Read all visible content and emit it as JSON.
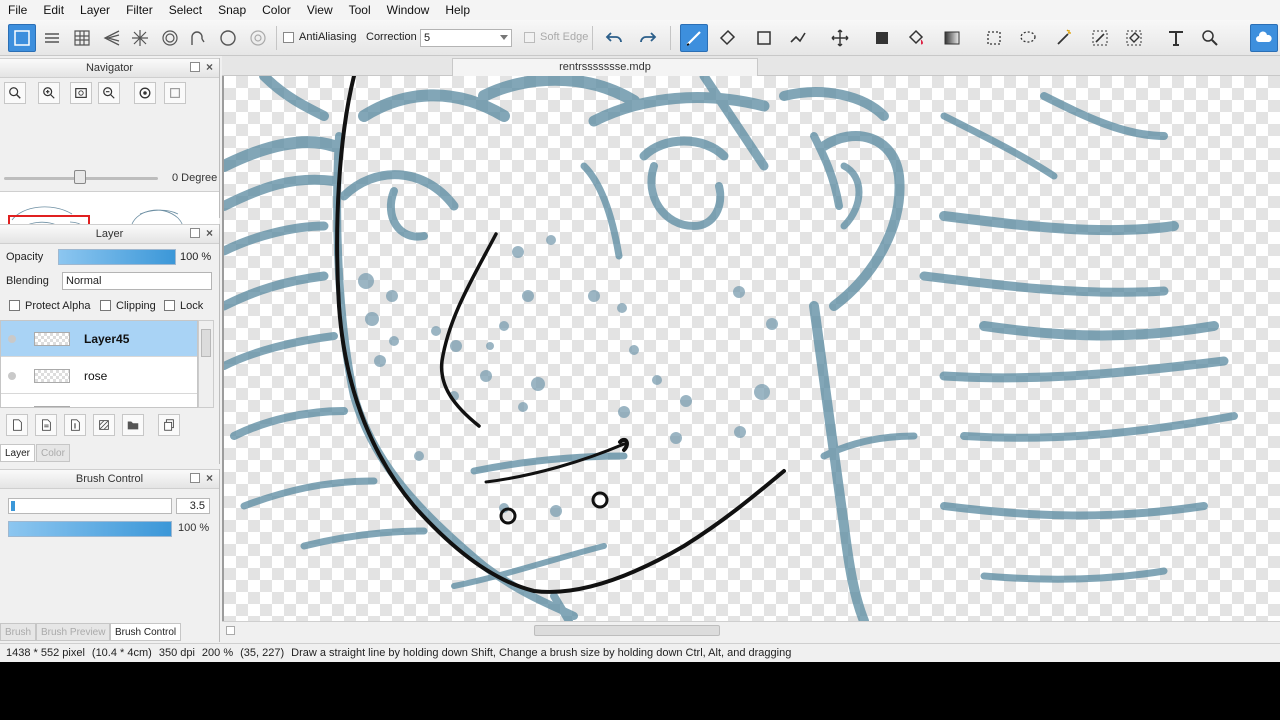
{
  "menu": [
    "File",
    "Edit",
    "Layer",
    "Filter",
    "Select",
    "Snap",
    "Color",
    "View",
    "Tool",
    "Window",
    "Help"
  ],
  "toolbar": {
    "antialiasing_label": "AntiAliasing",
    "correction_label": "Correction",
    "correction_value": "5",
    "soft_edge_label": "Soft Edge",
    "active_tool": "brush-icon"
  },
  "navigator": {
    "title": "Navigator",
    "rotation": "0 Degree"
  },
  "layer_panel": {
    "title": "Layer",
    "opacity_label": "Opacity",
    "opacity_value": "100 %",
    "opacity_fraction": 1.0,
    "blending_label": "Blending",
    "blending_value": "Normal",
    "protect_alpha_label": "Protect Alpha",
    "clipping_label": "Clipping",
    "lock_label": "Lock",
    "layers": [
      {
        "name": "Layer45",
        "selected": true
      },
      {
        "name": "rose",
        "selected": false
      }
    ],
    "tabs": [
      {
        "label": "Layer",
        "active": true
      },
      {
        "label": "Color",
        "active": false
      }
    ]
  },
  "brush_panel": {
    "title": "Brush Control",
    "size_value": "3.5",
    "density_value": "100 %",
    "density_fraction": 1.0,
    "tabs": [
      {
        "label": "Brush",
        "active": false
      },
      {
        "label": "Brush Preview",
        "active": false
      },
      {
        "label": "Brush Control",
        "active": true
      }
    ]
  },
  "document": {
    "tab_title": "rentrssssssse.mdp"
  },
  "status": {
    "size_px": "1438 * 552 pixel",
    "size_cm": "(10.4 * 4cm)",
    "dpi": "350 dpi",
    "zoom": "200 %",
    "cursor": "(35, 227)",
    "hint": "Draw a straight line by holding down Shift, Change a brush size by holding down Ctrl, Alt, and dragging"
  },
  "colors": {
    "accent": "#3d8fdd",
    "sketch_blue": "#5f8ea3",
    "ink": "#111111",
    "selected_layer": "#a9d3f5"
  }
}
